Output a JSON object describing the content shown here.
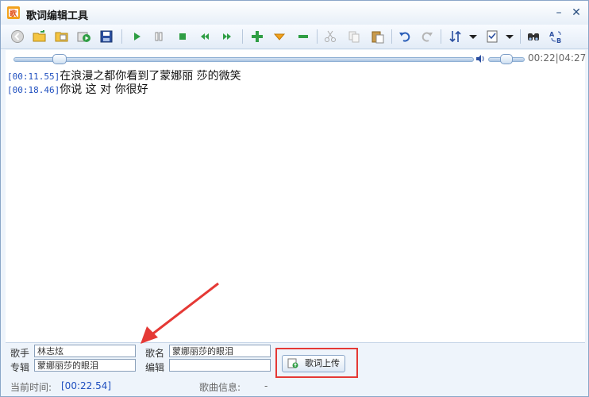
{
  "window": {
    "title": "歌词编辑工具",
    "minimize_glyph": "–",
    "close_glyph": "✕"
  },
  "toolbar": {
    "icons": [
      "back-icon",
      "open-folder-icon",
      "open-file-icon",
      "play-file-icon",
      "save-icon",
      "play-icon",
      "pause-icon",
      "stop-icon",
      "rewind-icon",
      "forward-icon",
      "add-icon",
      "insert-down-icon",
      "remove-icon",
      "cut-icon",
      "copy-icon",
      "paste-icon",
      "undo-icon",
      "redo-icon",
      "sort-icon",
      "dropdown-icon",
      "checklist-icon",
      "dropdown-icon",
      "find-icon",
      "replace-icon"
    ]
  },
  "player": {
    "progress": 0.086,
    "volume": 0.5,
    "current": "00:22",
    "total": "04:27"
  },
  "lyrics": [
    {
      "timestamp": "[00:11.55]",
      "text": "在浪漫之都你看到了蒙娜丽 莎的微笑"
    },
    {
      "timestamp": "[00:18.46]",
      "text": "你说 这 对 你很好"
    }
  ],
  "meta": {
    "singer_label": "歌手",
    "singer_value": "林志炫",
    "title_label": "歌名",
    "title_value": "蒙娜丽莎的眼泪",
    "album_label": "专辑",
    "album_value": "蒙娜丽莎的眼泪",
    "editor_label": "编辑",
    "editor_value": ""
  },
  "upload": {
    "label": "歌词上传"
  },
  "status": {
    "time_label": "当前时间:",
    "time_value": "[00:22.54]",
    "info_label": "歌曲信息:",
    "info_value": "-"
  },
  "colors": {
    "accent": "#1f4fbf",
    "annotation": "#e53935",
    "frame": "#8aa6c8"
  }
}
